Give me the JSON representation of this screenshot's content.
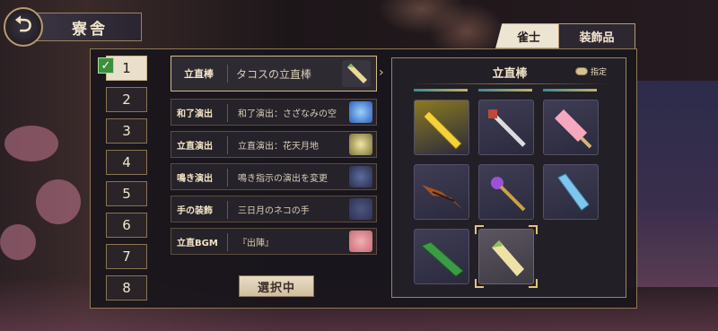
{
  "header": {
    "title": "寮舎",
    "back_icon": "back-arrow-icon"
  },
  "tabs": [
    {
      "label": "雀士",
      "active": false
    },
    {
      "label": "装飾品",
      "active": true
    }
  ],
  "slots": [
    {
      "label": "1",
      "selected": true,
      "checked": true
    },
    {
      "label": "2",
      "selected": false
    },
    {
      "label": "3",
      "selected": false
    },
    {
      "label": "4",
      "selected": false
    },
    {
      "label": "5",
      "selected": false
    },
    {
      "label": "6",
      "selected": false
    },
    {
      "label": "7",
      "selected": false
    },
    {
      "label": "8",
      "selected": false
    }
  ],
  "items": [
    {
      "category": "立直棒",
      "value": "タコスの立直棒",
      "selected": true,
      "thumb_color": "#d7c68a"
    },
    {
      "category": "和了演出",
      "value": "和了演出：さざなみの空",
      "selected": false,
      "thumb_color": "#2f5fb8"
    },
    {
      "category": "立直演出",
      "value": "立直演出：花天月地",
      "selected": false,
      "thumb_color": "#7a6f3a"
    },
    {
      "category": "鳴き演出",
      "value": "鳴き指示の演出を変更",
      "selected": false,
      "thumb_color": "#2b2f47"
    },
    {
      "category": "手の装飾",
      "value": "三日月のネコの手",
      "selected": false,
      "thumb_color": "#2f3350"
    },
    {
      "category": "立直BGM",
      "value": "『出陣』",
      "selected": false,
      "thumb_color": "#c86a72"
    }
  ],
  "status_button": "選択中",
  "panel": {
    "title": "立直棒",
    "fix_label": "指定",
    "grid": [
      {
        "name": "gold-stick-icon",
        "selected": false
      },
      {
        "name": "cross-stick-icon",
        "selected": false
      },
      {
        "name": "popsicle-stick-icon",
        "selected": false
      },
      {
        "name": "bat-wing-stick-icon",
        "selected": false
      },
      {
        "name": "purple-staff-icon",
        "selected": false
      },
      {
        "name": "ramune-bottle-icon",
        "selected": false
      },
      {
        "name": "green-lizard-stick-icon",
        "selected": false
      },
      {
        "name": "taco-stick-icon",
        "selected": true
      }
    ]
  },
  "colors": {
    "accent_gold": "#b89b6b",
    "selected_bg": "#e9dfcb",
    "check_green": "#3d8f3e"
  }
}
